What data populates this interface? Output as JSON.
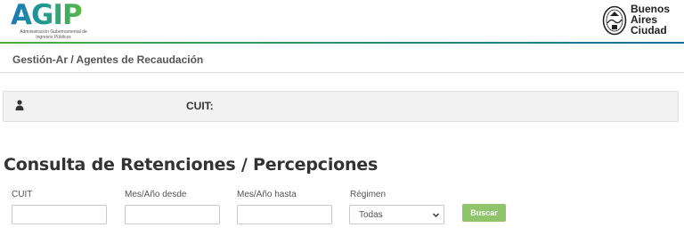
{
  "header": {
    "agip_logo_text": "AGIP",
    "agip_subtitle": "Administración Gubernamental de Ingresos Públicos",
    "city_logo_lines": [
      "Buenos",
      "Aires",
      "Ciudad"
    ]
  },
  "breadcrumb": "Gestión-Ar / Agentes de Recaudación",
  "user_bar": {
    "icon": "user-icon",
    "cuit_label": "CUIT:"
  },
  "page_title": "Consulta de Retenciones / Percepciones",
  "form": {
    "cuit": {
      "label": "CUIT",
      "value": ""
    },
    "mes_desde": {
      "label": "Mes/Año desde",
      "value": ""
    },
    "mes_hasta": {
      "label": "Mes/Año hasta",
      "value": ""
    },
    "regimen": {
      "label": "Régimen",
      "selected": "Todas"
    },
    "search_button": "Buscar"
  },
  "colors": {
    "accent_green": "#8fc46a",
    "agip_blue": "#1d77b8",
    "agip_green": "#5bb744"
  }
}
